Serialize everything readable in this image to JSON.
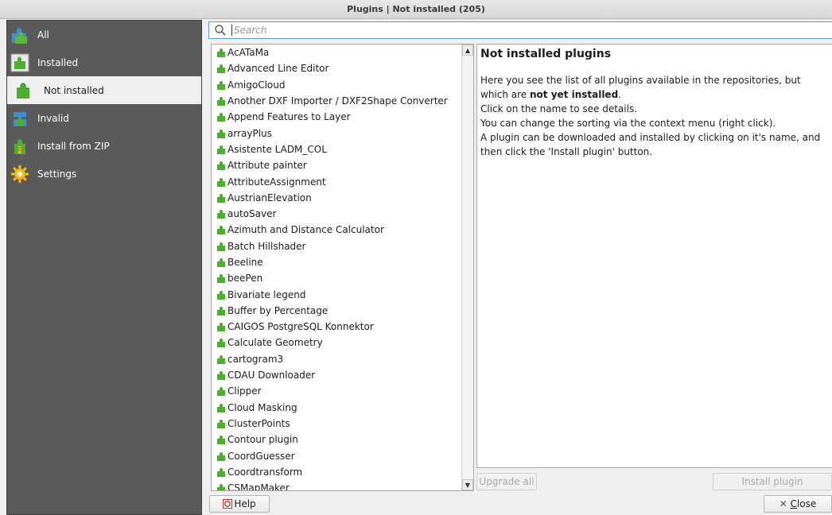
{
  "window": {
    "title": "Plugins | Not installed (205)"
  },
  "sidebar": {
    "items": [
      {
        "label": "All",
        "icon": "plugins-all-icon",
        "active": false
      },
      {
        "label": "Installed",
        "icon": "plugins-installed-icon",
        "active": false
      },
      {
        "label": "Not installed",
        "icon": "plugins-not-installed-icon",
        "active": true
      },
      {
        "label": "Invalid",
        "icon": "plugins-invalid-icon",
        "active": false
      },
      {
        "label": "Install from ZIP",
        "icon": "install-zip-icon",
        "active": false
      },
      {
        "label": "Settings",
        "icon": "settings-gear-icon",
        "active": false
      }
    ]
  },
  "search": {
    "placeholder": "Search",
    "value": ""
  },
  "plugin_list": {
    "items": [
      "AcATaMa",
      "Advanced Line Editor",
      "AmigoCloud",
      "Another DXF Importer / DXF2Shape Converter",
      "Append Features to Layer",
      "arrayPlus",
      "Asistente LADM_COL",
      "Attribute painter",
      "AttributeAssignment",
      "AustrianElevation",
      "autoSaver",
      "Azimuth and Distance Calculator",
      "Batch Hillshader",
      "Beeline",
      "beePen",
      "Bivariate legend",
      "Buffer by Percentage",
      "CAIGOS PostgreSQL Konnektor",
      "Calculate Geometry",
      "cartogram3",
      "CDAU Downloader",
      "Clipper",
      "Cloud Masking",
      "ClusterPoints",
      "Contour plugin",
      "CoordGuesser",
      "Coordtransform",
      "CSMapMaker"
    ]
  },
  "details": {
    "heading": "Not installed plugins",
    "intro_before": "Here you see the list of all plugins available in the repositories, but which are ",
    "intro_bold": "not yet installed",
    "intro_after": ".",
    "line2": "Click on the name to see details.",
    "line3": "You can change the sorting via the context menu (right click).",
    "line4": "A plugin can be downloaded and installed by clicking on it's name, and then click the 'Install plugin' button."
  },
  "buttons": {
    "upgrade_all": "Upgrade all",
    "install_plugin": "Install plugin",
    "help": "Help",
    "close_prefix": "✕ ",
    "close_mnemonic": "C",
    "close_rest": "lose"
  },
  "colors": {
    "sidebar_bg": "#5a5a5a",
    "accent_blue": "#5a9bd5",
    "plugin_green": "#4fae2d"
  }
}
